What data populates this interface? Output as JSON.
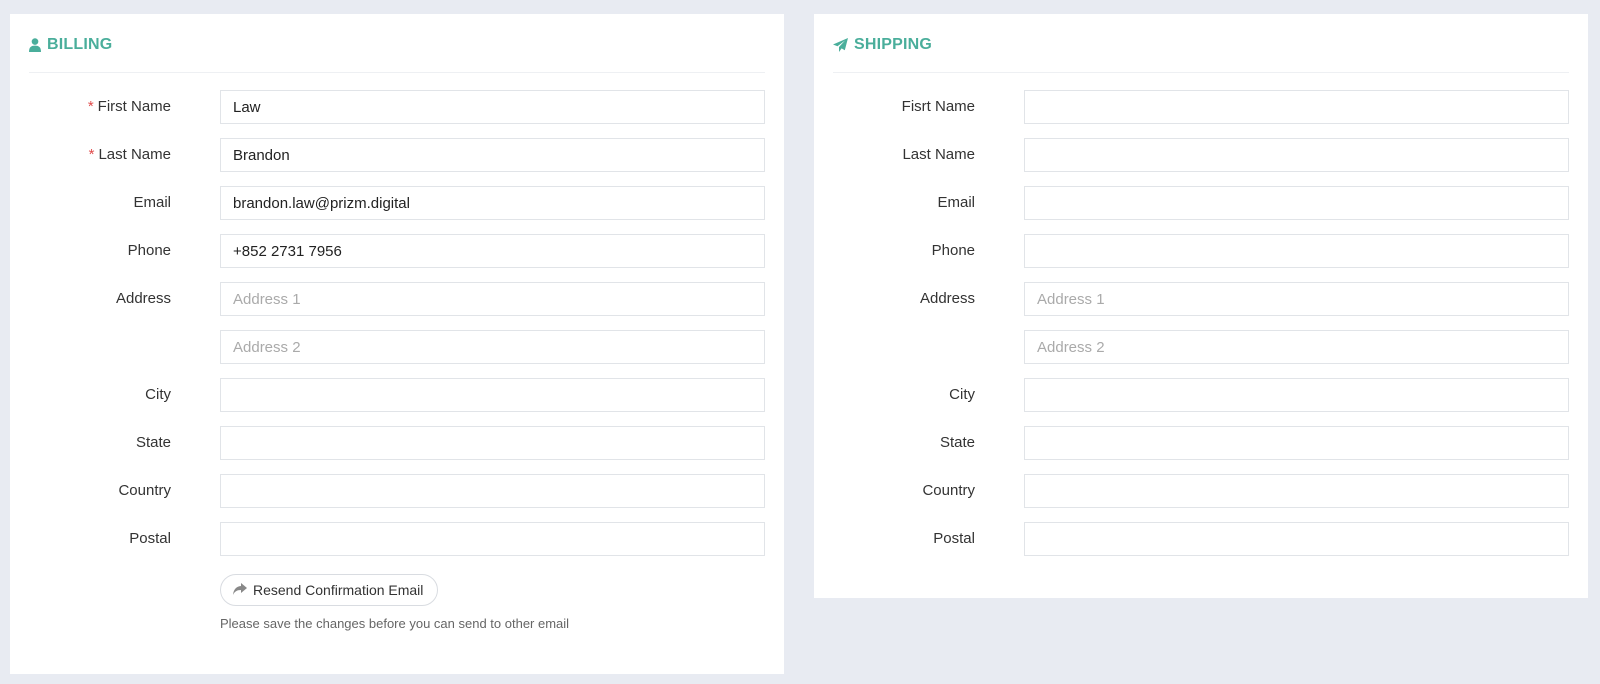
{
  "billing": {
    "title": "BILLING",
    "icon": "user-icon",
    "fields": {
      "first_name": {
        "label": "First Name",
        "required": true,
        "value": "Law",
        "placeholder": ""
      },
      "last_name": {
        "label": "Last Name",
        "required": true,
        "value": "Brandon",
        "placeholder": ""
      },
      "email": {
        "label": "Email",
        "value": "brandon.law@prizm.digital",
        "placeholder": ""
      },
      "phone": {
        "label": "Phone",
        "value": "+852 2731 7956",
        "placeholder": ""
      },
      "address": {
        "label": "Address",
        "value1": "",
        "placeholder1": "Address 1",
        "value2": "",
        "placeholder2": "Address 2"
      },
      "city": {
        "label": "City",
        "value": "",
        "placeholder": ""
      },
      "state": {
        "label": "State",
        "value": "",
        "placeholder": ""
      },
      "country": {
        "label": "Country",
        "value": "",
        "placeholder": ""
      },
      "postal": {
        "label": "Postal",
        "value": "",
        "placeholder": ""
      }
    },
    "required_marker": "*",
    "resend_button": "Resend Confirmation Email",
    "resend_icon": "share-arrow-icon",
    "help_text": "Please save the changes before you can send to other email"
  },
  "shipping": {
    "title": "SHIPPING",
    "icon": "paper-plane-icon",
    "fields": {
      "first_name": {
        "label": "Fisrt Name",
        "value": "",
        "placeholder": ""
      },
      "last_name": {
        "label": "Last Name",
        "value": "",
        "placeholder": ""
      },
      "email": {
        "label": "Email",
        "value": "",
        "placeholder": ""
      },
      "phone": {
        "label": "Phone",
        "value": "",
        "placeholder": ""
      },
      "address": {
        "label": "Address",
        "value1": "",
        "placeholder1": "Address 1",
        "value2": "",
        "placeholder2": "Address 2"
      },
      "city": {
        "label": "City",
        "value": "",
        "placeholder": ""
      },
      "state": {
        "label": "State",
        "value": "",
        "placeholder": ""
      },
      "country": {
        "label": "Country",
        "value": "",
        "placeholder": ""
      },
      "postal": {
        "label": "Postal",
        "value": "",
        "placeholder": ""
      }
    }
  },
  "colors": {
    "accent": "#4aae9b",
    "required": "#e04b4b",
    "page_background": "#e8ebf2"
  }
}
